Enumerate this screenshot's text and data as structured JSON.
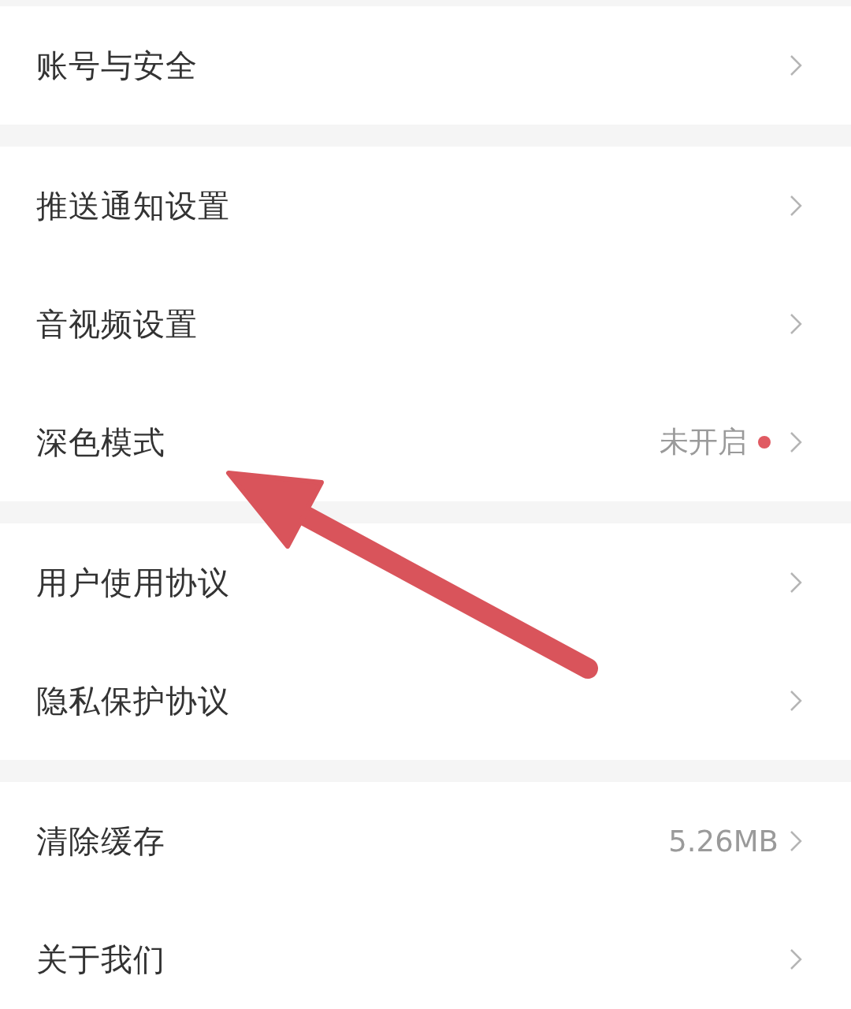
{
  "groups": [
    {
      "items": [
        {
          "label": "账号与安全"
        }
      ]
    },
    {
      "items": [
        {
          "label": "推送通知设置"
        },
        {
          "label": "音视频设置"
        },
        {
          "label": "深色模式",
          "value": "未开启",
          "badge": true
        }
      ]
    },
    {
      "items": [
        {
          "label": "用户使用协议"
        },
        {
          "label": "隐私保护协议"
        }
      ]
    },
    {
      "items": [
        {
          "label": "清除缓存",
          "value": "5.26MB"
        },
        {
          "label": "关于我们"
        }
      ]
    }
  ],
  "annotation": {
    "kind": "arrow"
  }
}
